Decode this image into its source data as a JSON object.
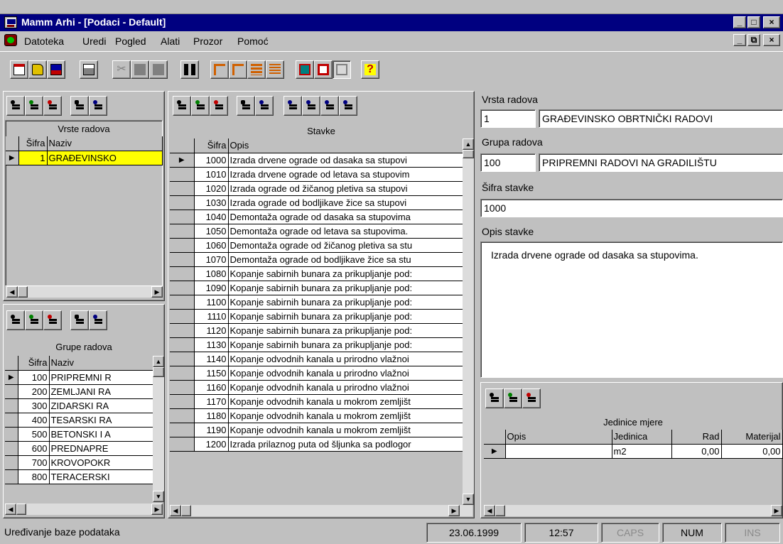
{
  "window": {
    "title": "Mamm Arhi - [Podaci - Default]",
    "min_glyph": "_",
    "max_glyph": "□",
    "close_glyph": "×",
    "restore_glyph": "⧉"
  },
  "menu": [
    "Datoteka",
    "Uredi",
    "Pogled",
    "Alati",
    "Prozor",
    "Pomoć"
  ],
  "colors": {
    "titlebar": "#000080",
    "selected_row": "#ffff00",
    "face": "#c0c0c0"
  },
  "vrste": {
    "caption": "Vrste radova",
    "col_sifra": "Šifra",
    "col_naziv": "Naziv",
    "rows": [
      {
        "sifra": "1",
        "naziv": "GRAĐEVINSKO"
      }
    ]
  },
  "grupe": {
    "caption": "Grupe radova",
    "col_sifra": "Šifra",
    "col_naziv": "Naziv",
    "rows": [
      {
        "sifra": "100",
        "naziv": "PRIPREMNI R"
      },
      {
        "sifra": "200",
        "naziv": "ZEMLJANI RA"
      },
      {
        "sifra": "300",
        "naziv": "ZIDARSKI RA"
      },
      {
        "sifra": "400",
        "naziv": "TESARSKI RA"
      },
      {
        "sifra": "500",
        "naziv": "BETONSKI I A"
      },
      {
        "sifra": "600",
        "naziv": "PREDNAPRE"
      },
      {
        "sifra": "700",
        "naziv": "KROVOPOKR"
      },
      {
        "sifra": "800",
        "naziv": "TERACERSKI"
      }
    ]
  },
  "stavke": {
    "caption": "Stavke",
    "col_sifra": "Šifra",
    "col_opis": "Opis",
    "rows": [
      {
        "sifra": "1000",
        "opis": "Izrada drvene ograde od dasaka sa stupovi"
      },
      {
        "sifra": "1010",
        "opis": "Izrada drvene ograde od letava sa stupovim"
      },
      {
        "sifra": "1020",
        "opis": "Izrada ograde od žičanog pletiva sa stupovi"
      },
      {
        "sifra": "1030",
        "opis": "Izrada ograde od bodljikave žice sa stupovi"
      },
      {
        "sifra": "1040",
        "opis": "Demontaža ograde od dasaka sa stupovima"
      },
      {
        "sifra": "1050",
        "opis": "Demontaža ograde od letava sa stupovima."
      },
      {
        "sifra": "1060",
        "opis": "Demontaža ograde od žičanog pletiva sa stu"
      },
      {
        "sifra": "1070",
        "opis": "Demontaža ograde od bodljikave žice sa stu"
      },
      {
        "sifra": "1080",
        "opis": "Kopanje sabirnih bunara za prikupljanje pod:"
      },
      {
        "sifra": "1090",
        "opis": "Kopanje sabirnih bunara za prikupljanje pod:"
      },
      {
        "sifra": "1100",
        "opis": "Kopanje sabirnih bunara za prikupljanje pod:"
      },
      {
        "sifra": "1110",
        "opis": "Kopanje sabirnih bunara za prikupljanje pod:"
      },
      {
        "sifra": "1120",
        "opis": "Kopanje sabirnih bunara za prikupljanje pod:"
      },
      {
        "sifra": "1130",
        "opis": "Kopanje sabirnih bunara za prikupljanje pod:"
      },
      {
        "sifra": "1140",
        "opis": "Kopanje odvodnih kanala u prirodno vlažnoi"
      },
      {
        "sifra": "1150",
        "opis": "Kopanje odvodnih kanala u prirodno vlažnoi"
      },
      {
        "sifra": "1160",
        "opis": "Kopanje odvodnih kanala u prirodno vlažnoi"
      },
      {
        "sifra": "1170",
        "opis": "Kopanje odvodnih kanala u mokrom zemljišt"
      },
      {
        "sifra": "1180",
        "opis": "Kopanje odvodnih kanala u mokrom zemljišt"
      },
      {
        "sifra": "1190",
        "opis": "Kopanje odvodnih kanala u mokrom zemljišt"
      },
      {
        "sifra": "1200",
        "opis": "Izrada prilaznog puta od šljunka sa podlogor"
      }
    ]
  },
  "form": {
    "vrsta_label": "Vrsta radova",
    "vrsta_sifra": "1",
    "vrsta_naziv": "GRAĐEVINSKO OBRTNIČKI RADOVI",
    "grupa_label": "Grupa radova",
    "grupa_sifra": "100",
    "grupa_naziv": "PRIPREMNI RADOVI NA GRADILIŠTU",
    "sifra_label": "Šifra stavke",
    "sifra_value": "1000",
    "opis_label": "Opis stavke",
    "opis_value": "Izrada drvene ograde od dasaka sa stupovima."
  },
  "jedinice": {
    "caption": "Jedinice mjere",
    "col_opis": "Opis",
    "col_jedinica": "Jedinica",
    "col_rad": "Rad",
    "col_materijal": "Materijal",
    "rows": [
      {
        "opis": "",
        "jedinica": "m2",
        "rad": "0,00",
        "materijal": "0,00"
      }
    ]
  },
  "status": {
    "message": "Uređivanje baze podataka",
    "date": "23.06.1999",
    "time": "12:57",
    "caps": "CAPS",
    "num": "NUM",
    "ins": "INS"
  }
}
